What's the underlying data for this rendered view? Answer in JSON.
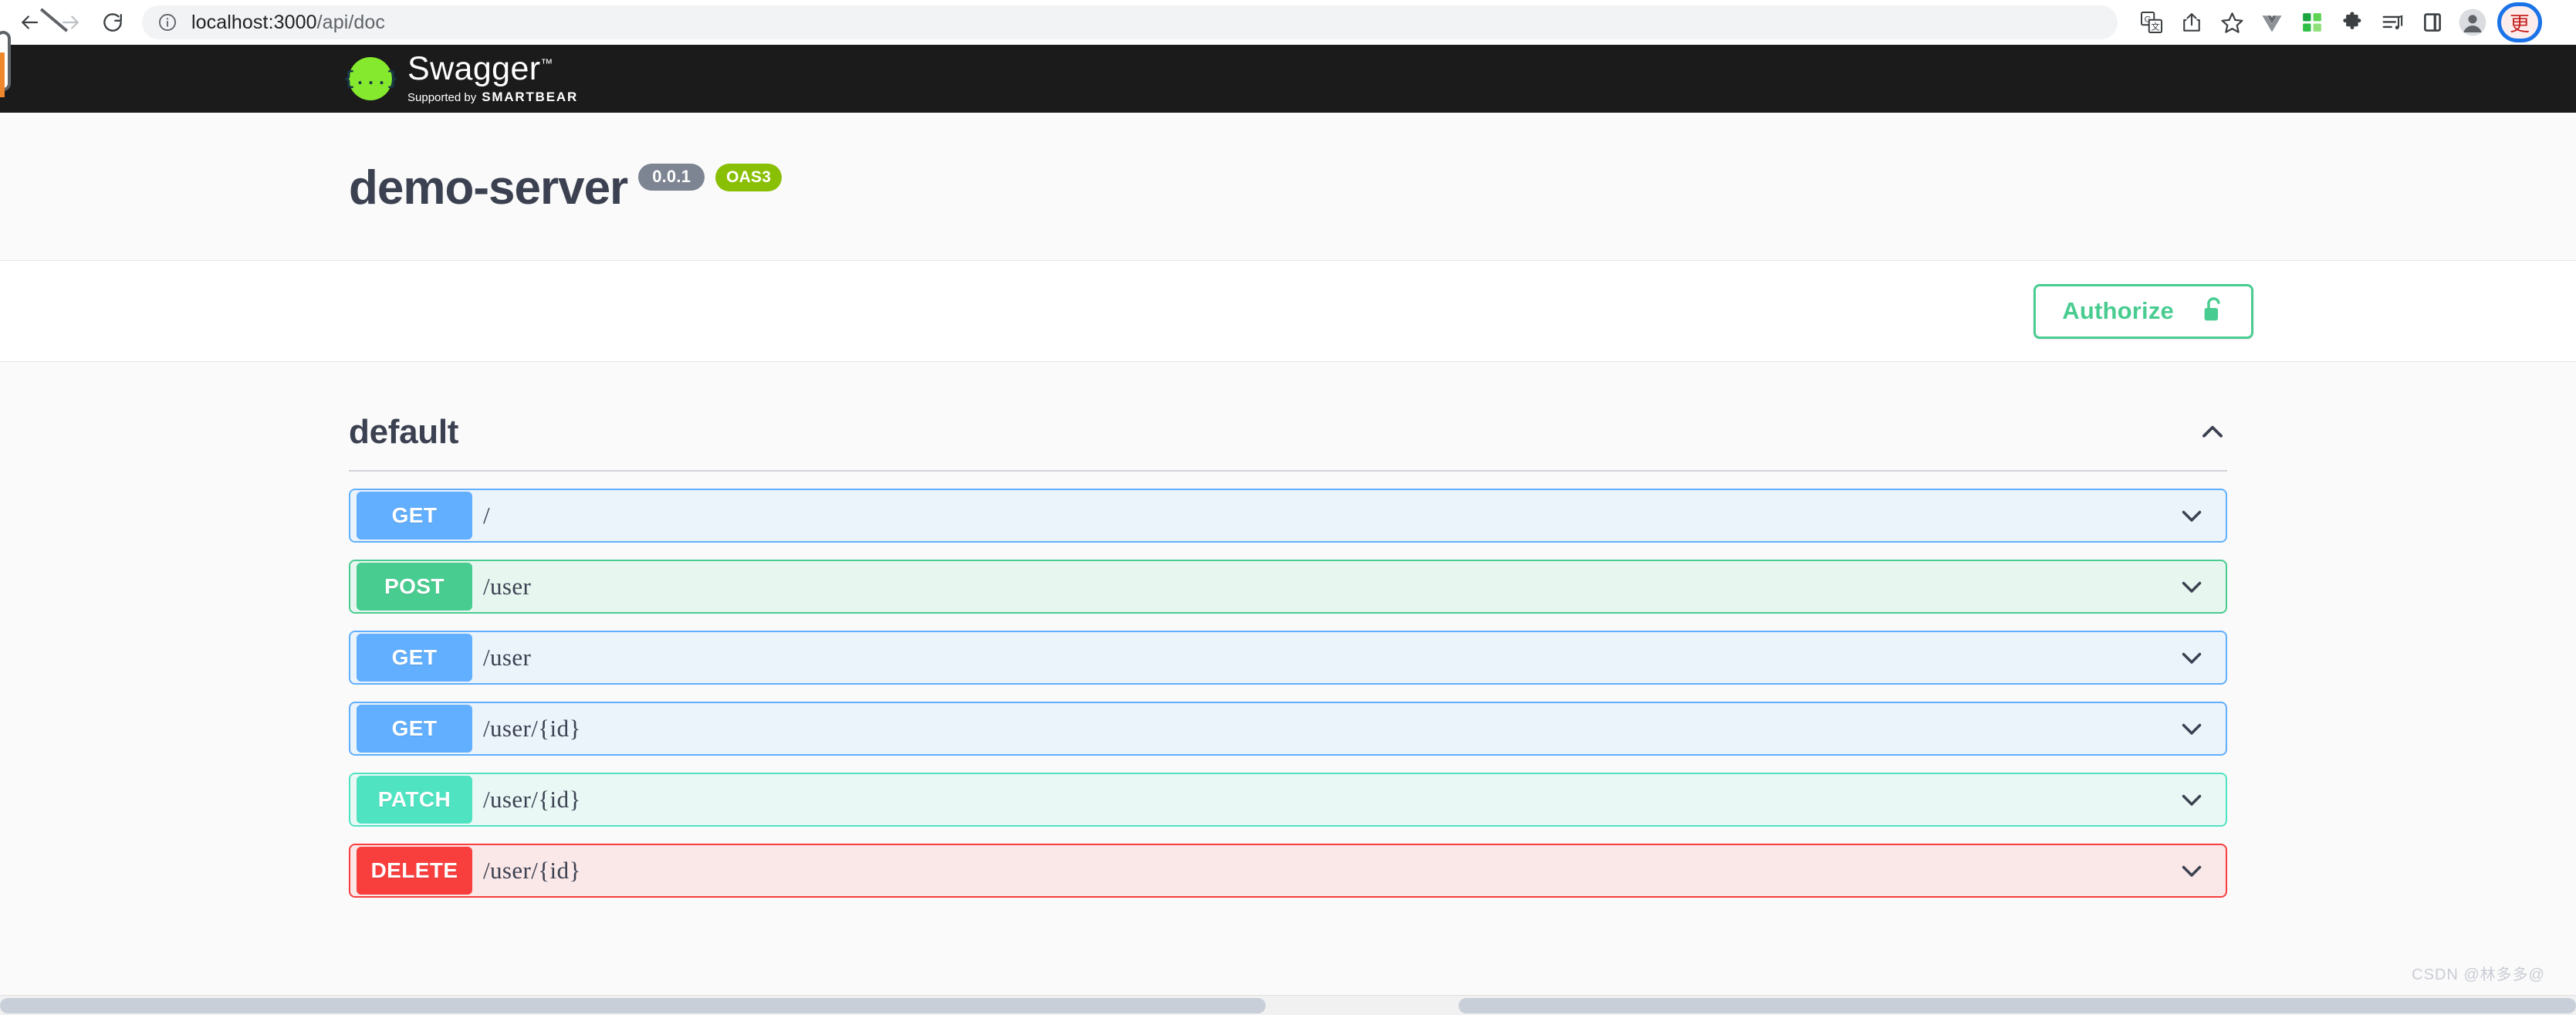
{
  "browser": {
    "back_label": "Back",
    "forward_label": "Forward",
    "reload_label": "Reload",
    "url_protocol_host": "localhost:3000",
    "url_path": "/api/doc",
    "url_full": "localhost:3000/api/doc",
    "toolbar_icons": [
      {
        "name": "translate-icon",
        "label": "Translate this page"
      },
      {
        "name": "share-icon",
        "label": "Share this page"
      },
      {
        "name": "bookmark-star-icon",
        "label": "Bookmark this tab"
      },
      {
        "name": "vue-devtools-icon",
        "label": "Vue.js devtools"
      },
      {
        "name": "qr-code-extension-icon",
        "label": "QR code extension"
      },
      {
        "name": "extensions-puzzle-icon",
        "label": "Extensions"
      },
      {
        "name": "media-playlist-icon",
        "label": "Media controls"
      },
      {
        "name": "side-panel-icon",
        "label": "Side panel"
      },
      {
        "name": "profile-avatar-icon",
        "label": "Profile"
      }
    ],
    "update_button_label": "更"
  },
  "topbar": {
    "logo_title": "Swagger",
    "logo_trademark": "™",
    "logo_glyph": "{...}",
    "supported_by": "Supported by",
    "brand": "SMARTBEAR",
    "logo_color": "#85ea2d",
    "bar_color": "#1b1b1b"
  },
  "info": {
    "title": "demo-server",
    "version_badge": "0.0.1",
    "spec_badge": "OAS3",
    "version_badge_color": "#7d8492",
    "spec_badge_color": "#89bf04"
  },
  "auth": {
    "authorize_label": "Authorize",
    "lock_icon": "unlocked-padlock-icon",
    "accent_color": "#49cc90"
  },
  "section": {
    "title": "default",
    "expanded": true,
    "toggle_icon": "chevron-up-icon"
  },
  "operations": [
    {
      "method": "GET",
      "path": "/",
      "style": "get",
      "badge_color": "#61affe",
      "row_color": "#ebf3fb",
      "toggle_icon": "chevron-down-icon"
    },
    {
      "method": "POST",
      "path": "/user",
      "style": "post",
      "badge_color": "#49cc90",
      "row_color": "#e8f6f0",
      "toggle_icon": "chevron-down-icon"
    },
    {
      "method": "GET",
      "path": "/user",
      "style": "get",
      "badge_color": "#61affe",
      "row_color": "#ebf3fb",
      "toggle_icon": "chevron-down-icon"
    },
    {
      "method": "GET",
      "path": "/user/{id}",
      "style": "get",
      "badge_color": "#61affe",
      "row_color": "#ebf3fb",
      "toggle_icon": "chevron-down-icon"
    },
    {
      "method": "PATCH",
      "path": "/user/{id}",
      "style": "patch",
      "badge_color": "#50e3c2",
      "row_color": "#e9f8f5",
      "toggle_icon": "chevron-down-icon"
    },
    {
      "method": "DELETE",
      "path": "/user/{id}",
      "style": "delete",
      "badge_color": "#f93e3e",
      "row_color": "#fae7e7",
      "toggle_icon": "chevron-down-icon"
    }
  ],
  "watermark": "CSDN @林多多@"
}
